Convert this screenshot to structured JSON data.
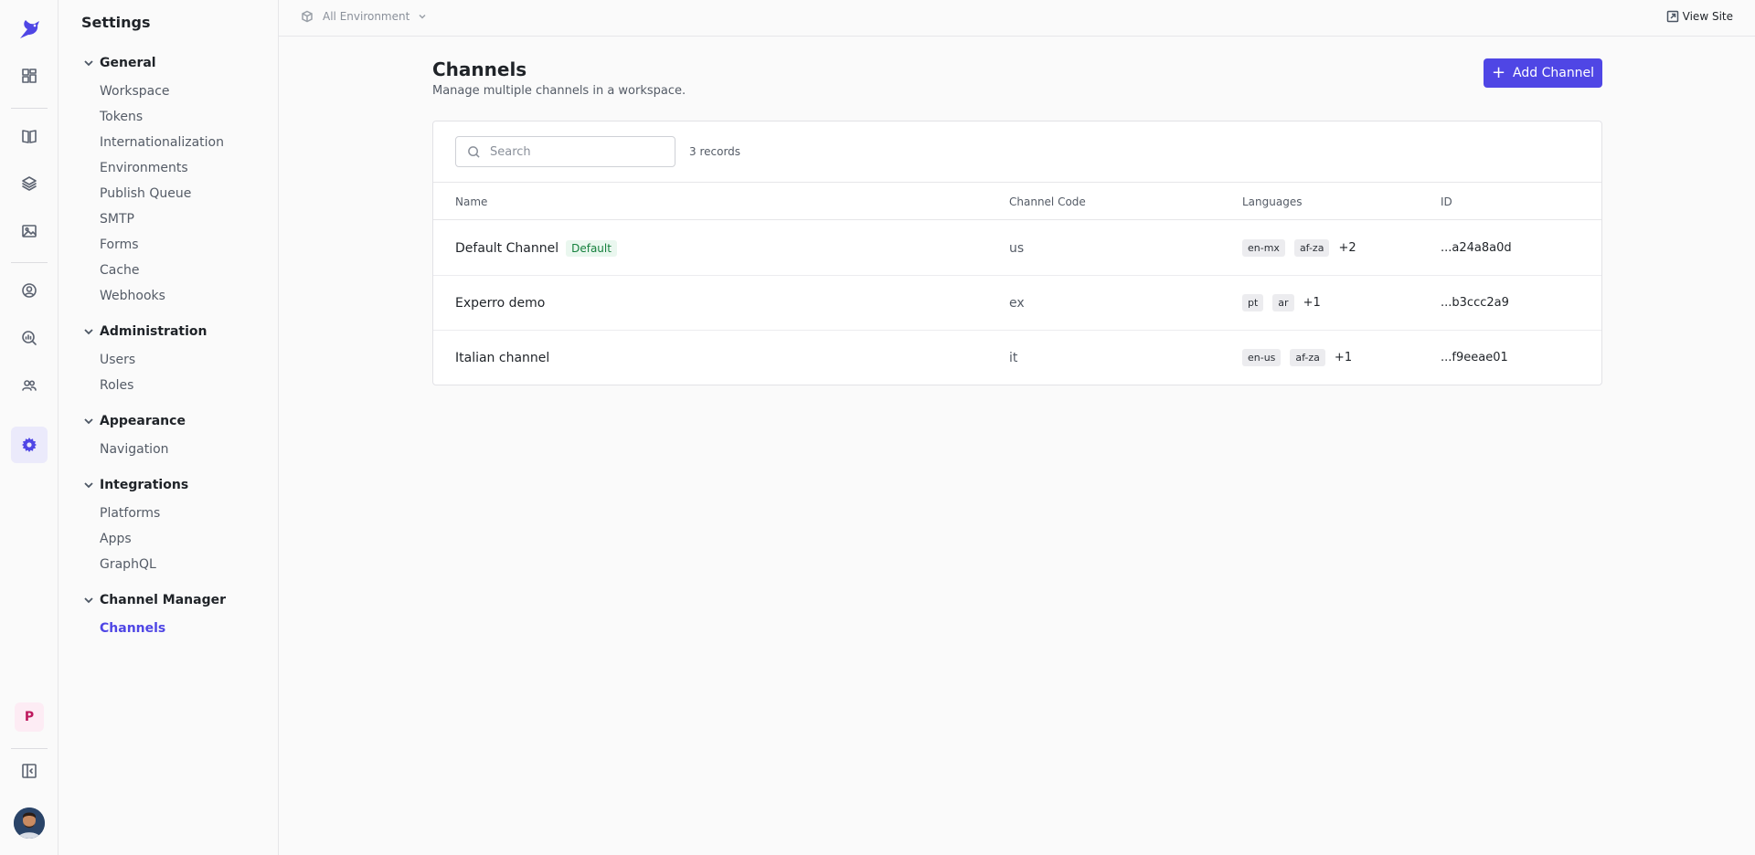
{
  "rail": {
    "icons": [
      "logo-bird-icon",
      "dashboard-grid-icon",
      "book-icon",
      "layers-icon",
      "image-icon",
      "user-circle-icon",
      "analytics-search-icon",
      "users-icon",
      "settings-gear-icon",
      "collapse-sidebar-icon"
    ],
    "user_initial": "P"
  },
  "sidebar": {
    "title": "Settings",
    "groups": [
      {
        "label": "General",
        "items": [
          "Workspace",
          "Tokens",
          "Internationalization",
          "Environments",
          "Publish Queue",
          "SMTP",
          "Forms",
          "Cache",
          "Webhooks"
        ]
      },
      {
        "label": "Administration",
        "items": [
          "Users",
          "Roles"
        ]
      },
      {
        "label": "Appearance",
        "items": [
          "Navigation"
        ]
      },
      {
        "label": "Integrations",
        "items": [
          "Platforms",
          "Apps",
          "GraphQL"
        ]
      },
      {
        "label": "Channel Manager",
        "items": [
          "Channels"
        ]
      }
    ]
  },
  "topbar": {
    "environment": "All Environment",
    "view_site": "View Site"
  },
  "main": {
    "title": "Channels",
    "subtitle": "Manage multiple channels in a workspace.",
    "add_button": "Add Channel",
    "search_placeholder": "Search",
    "records": "3 records",
    "columns": [
      "Name",
      "Channel Code",
      "Languages",
      "ID"
    ],
    "rows": [
      {
        "name": "Default Channel",
        "badge": "Default",
        "code": "us",
        "languages": [
          "en-mx",
          "af-za"
        ],
        "more": "+2",
        "id": "...a24a8a0d"
      },
      {
        "name": "Experro demo",
        "badge": "",
        "code": "ex",
        "languages": [
          "pt",
          "ar"
        ],
        "more": "+1",
        "id": "...b3ccc2a9"
      },
      {
        "name": "Italian channel",
        "badge": "",
        "code": "it",
        "languages": [
          "en-us",
          "af-za"
        ],
        "more": "+1",
        "id": "...f9eeae01"
      }
    ]
  },
  "colors": {
    "accent": "#4f46e5",
    "default_badge_bg": "#eaf7ef",
    "default_badge_text": "#15803d"
  }
}
